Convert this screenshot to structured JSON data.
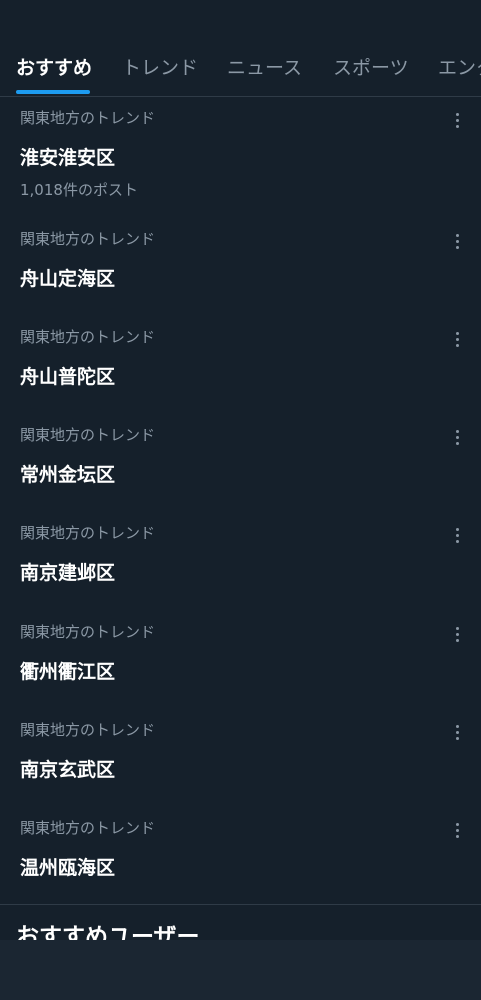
{
  "tabs": [
    {
      "label": "おすすめ",
      "active": true
    },
    {
      "label": "トレンド",
      "active": false
    },
    {
      "label": "ニュース",
      "active": false
    },
    {
      "label": "スポーツ",
      "active": false
    },
    {
      "label": "エンタ",
      "active": false
    }
  ],
  "trends": [
    {
      "context": "関東地方のトレンド",
      "name": "淮安淮安区",
      "count": "1,018件のポスト"
    },
    {
      "context": "関東地方のトレンド",
      "name": "舟山定海区"
    },
    {
      "context": "関東地方のトレンド",
      "name": "舟山普陀区"
    },
    {
      "context": "関東地方のトレンド",
      "name": "常州金坛区"
    },
    {
      "context": "関東地方のトレンド",
      "name": "南京建邺区"
    },
    {
      "context": "関東地方のトレンド",
      "name": "衢州衢江区"
    },
    {
      "context": "関東地方のトレンド",
      "name": "南京玄武区"
    },
    {
      "context": "関東地方のトレンド",
      "name": "温州瓯海区"
    }
  ],
  "recommended_users": {
    "heading": "おすすめユーザー"
  },
  "icons": {
    "more": "more-vertical-icon"
  },
  "colors": {
    "background": "#15202b",
    "accent": "#1d9bf0",
    "secondary_text": "#8b98a5",
    "divider": "#2f3b47"
  }
}
